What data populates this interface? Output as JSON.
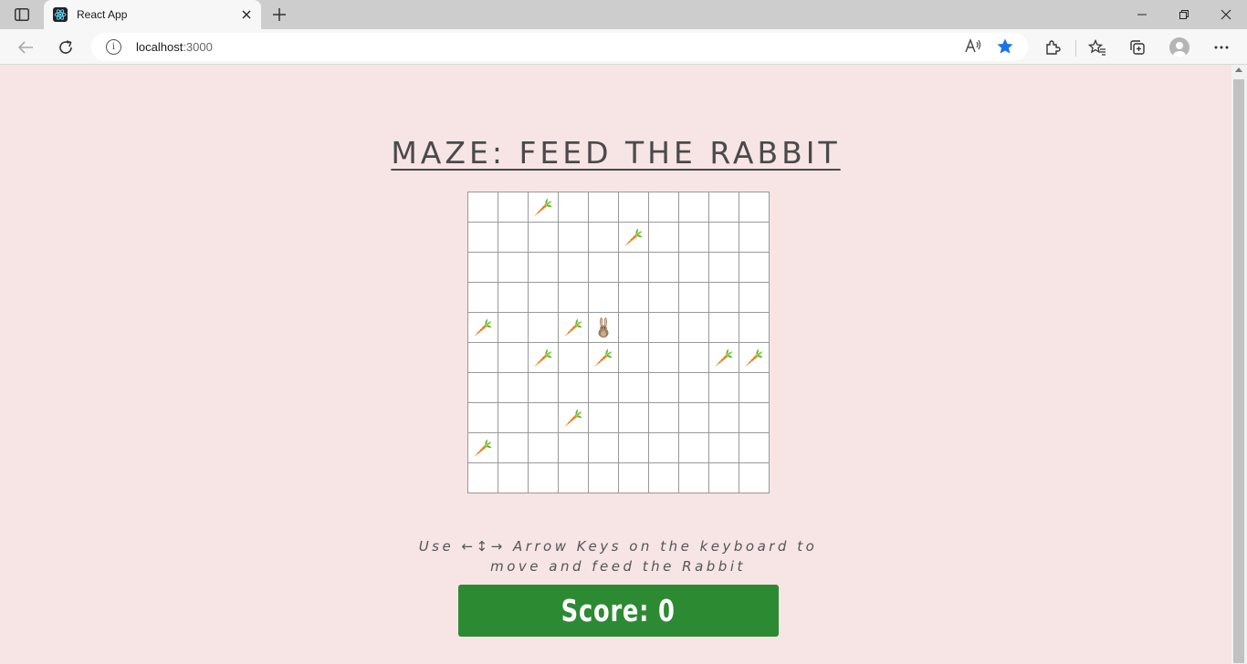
{
  "browser": {
    "tab_title": "React App",
    "url_host": "localhost",
    "url_port": ":3000"
  },
  "page": {
    "title": "MAZE: FEED THE RABBIT",
    "instructions_line1": "Use ←↕→ Arrow Keys on the keyboard to",
    "instructions_line2": "move and feed the Rabbit",
    "score_text": "Score: 0"
  },
  "maze": {
    "rows": 10,
    "cols": 10,
    "rabbit": [
      4,
      4
    ],
    "carrots": [
      [
        0,
        2
      ],
      [
        1,
        5
      ],
      [
        4,
        0
      ],
      [
        4,
        3
      ],
      [
        5,
        2
      ],
      [
        5,
        4
      ],
      [
        5,
        8
      ],
      [
        5,
        9
      ],
      [
        7,
        3
      ],
      [
        8,
        0
      ]
    ]
  },
  "colors": {
    "page_background": "#f7e4e4",
    "score_background": "#2c8a32",
    "title_text": "#4a4a4a"
  },
  "icons": {
    "carrot": "carrot-icon",
    "rabbit": "rabbit-icon"
  }
}
